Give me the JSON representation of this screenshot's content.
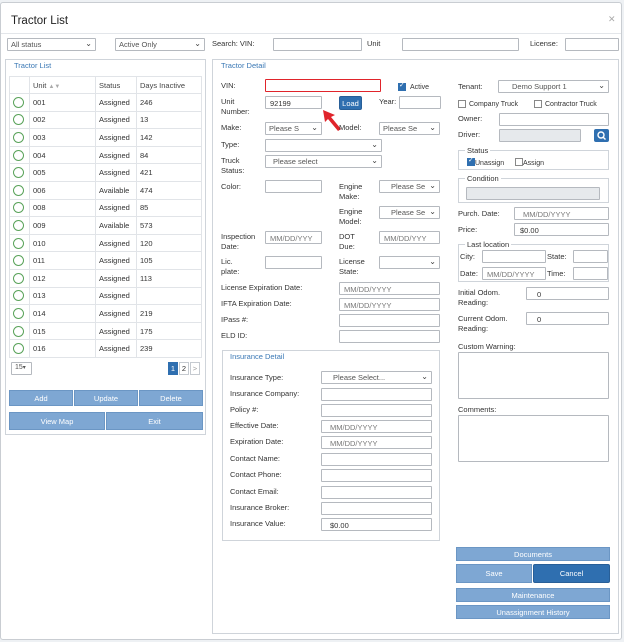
{
  "window": {
    "title": "Tractor List",
    "close_icon": "✕"
  },
  "filters": {
    "status": "All status",
    "active": "Active Only",
    "search_vin_label": "Search: VIN:",
    "unit_label": "Unit",
    "license_label": "License:"
  },
  "list": {
    "title": "Tractor List",
    "columns": [
      "Unit",
      "Status",
      "Days Inactive"
    ],
    "sort_indicator": "▲▼",
    "rows": [
      {
        "unit": "001",
        "status": "Assigned",
        "days": "246"
      },
      {
        "unit": "002",
        "status": "Assigned",
        "days": "13"
      },
      {
        "unit": "003",
        "status": "Assigned",
        "days": "142"
      },
      {
        "unit": "004",
        "status": "Assigned",
        "days": "84"
      },
      {
        "unit": "005",
        "status": "Assigned",
        "days": "421"
      },
      {
        "unit": "006",
        "status": "Available",
        "days": "474"
      },
      {
        "unit": "008",
        "status": "Assigned",
        "days": "85"
      },
      {
        "unit": "009",
        "status": "Available",
        "days": "573"
      },
      {
        "unit": "010",
        "status": "Assigned",
        "days": "120"
      },
      {
        "unit": "011",
        "status": "Assigned",
        "days": "105"
      },
      {
        "unit": "012",
        "status": "Assigned",
        "days": "113"
      },
      {
        "unit": "013",
        "status": "Assigned",
        "days": ""
      },
      {
        "unit": "014",
        "status": "Assigned",
        "days": "219"
      },
      {
        "unit": "015",
        "status": "Assigned",
        "days": "175"
      },
      {
        "unit": "016",
        "status": "Assigned",
        "days": "239"
      }
    ],
    "page_size": "15",
    "pages": [
      "1",
      "2"
    ],
    "next": ">",
    "buttons": {
      "add": "Add",
      "update": "Update",
      "delete": "Delete",
      "view_map": "View Map",
      "exit": "Exit"
    }
  },
  "detail": {
    "title": "Tractor Detail",
    "vin_label": "VIN:",
    "active_label": "Active",
    "unit_number_label": "Unit Number:",
    "unit_number_value": "92199",
    "load_button": "Load",
    "year_label": "Year:",
    "make_label": "Make:",
    "make_value": "Please S",
    "model_label": "Model:",
    "model_value": "Please Se",
    "type_label": "Type:",
    "truck_status_label": "Truck Status:",
    "truck_status_value": "Please select",
    "color_label": "Color:",
    "engine_make_label": "Engine Make:",
    "engine_make_value": "Please Se",
    "engine_model_label": "Engine Model:",
    "engine_model_value": "Please Se",
    "inspection_label": "Inspection Date:",
    "inspection_placeholder": "MM/DD/YYY",
    "dot_label": "DOT Due:",
    "dot_placeholder": "MM/DD/YYY",
    "lic_plate_label": "Lic. plate:",
    "license_state_label": "License State:",
    "license_exp_label": "License Expiration Date:",
    "license_exp_placeholder": "MM/DD/YYYY",
    "ifta_exp_label": "IFTA Expiration Date:",
    "ifta_exp_placeholder": "MM/DD/YYYY",
    "ipass_label": "IPass #:",
    "eld_label": "ELD ID:"
  },
  "insurance": {
    "title": "Insurance Detail",
    "type_label": "Insurance Type:",
    "type_value": "Please Select...",
    "company_label": "Insurance Company:",
    "policy_label": "Policy #:",
    "effective_label": "Effective Date:",
    "effective_placeholder": "MM/DD/YYYY",
    "expiration_label": "Expiration Date:",
    "expiration_placeholder": "MM/DD/YYYY",
    "contact_name_label": "Contact Name:",
    "contact_phone_label": "Contact Phone:",
    "contact_email_label": "Contact Email:",
    "broker_label": "Insurance Broker:",
    "value_label": "Insurance Value:",
    "value_value": "$0.00"
  },
  "right": {
    "tenant_label": "Tenant:",
    "tenant_value": "Demo Support 1",
    "company_truck_label": "Company Truck",
    "contractor_truck_label": "Contractor Truck",
    "owner_label": "Owner:",
    "driver_label": "Driver:",
    "status_legend": "Status",
    "unassign_label": "Unassign",
    "assign_label": "Assign",
    "condition_legend": "Condition",
    "purch_date_label": "Purch. Date:",
    "purch_date_placeholder": "MM/DD/YYYY",
    "price_label": "Price:",
    "price_value": "$0.00",
    "last_location_legend": "Last location",
    "city_label": "City:",
    "state_label": "State:",
    "date_label": "Date:",
    "date_placeholder": "MM/DD/YYYY",
    "time_label": "Time:",
    "initial_odom_label": "Initial Odom. Reading:",
    "initial_odom_value": "0",
    "current_odom_label": "Current Odom. Reading:",
    "current_odom_value": "0",
    "custom_warning_label": "Custom Warning:",
    "comments_label": "Comments:"
  },
  "actions": {
    "documents": "Documents",
    "save": "Save",
    "cancel": "Cancel",
    "maintenance": "Maintenance",
    "unassignment_history": "Unassignment History"
  },
  "colors": {
    "accent": "#2f6fb0",
    "light_button": "#7ea7d3",
    "arrow": "#e0242b",
    "circle": "#5aa35a"
  }
}
